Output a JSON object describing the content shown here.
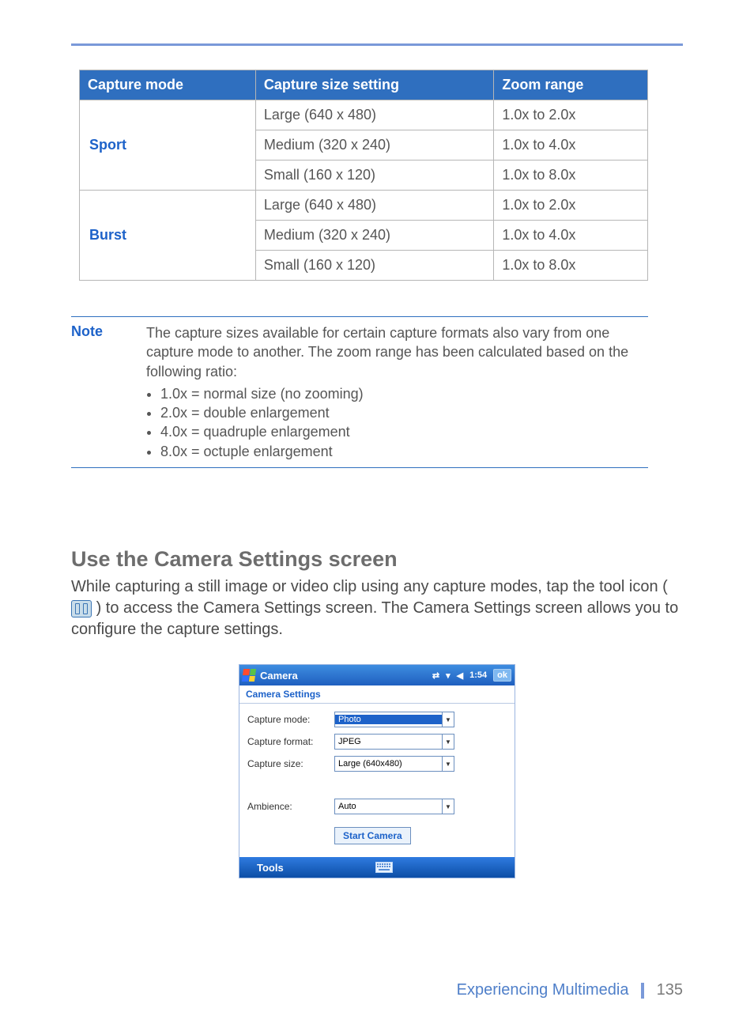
{
  "table": {
    "headers": [
      "Capture mode",
      "Capture size setting",
      "Zoom range"
    ],
    "groups": [
      {
        "mode": "Sport",
        "rows": [
          {
            "size": "Large (640 x 480)",
            "zoom": "1.0x to 2.0x"
          },
          {
            "size": "Medium (320 x 240)",
            "zoom": "1.0x to 4.0x"
          },
          {
            "size": "Small (160 x 120)",
            "zoom": "1.0x to 8.0x"
          }
        ]
      },
      {
        "mode": "Burst",
        "rows": [
          {
            "size": "Large (640 x 480)",
            "zoom": "1.0x to 2.0x"
          },
          {
            "size": "Medium (320 x 240)",
            "zoom": "1.0x to 4.0x"
          },
          {
            "size": "Small (160 x 120)",
            "zoom": "1.0x to 8.0x"
          }
        ]
      }
    ]
  },
  "note": {
    "label": "Note",
    "text": "The capture sizes available for certain capture formats also vary from one capture mode to another. The zoom range has been calculated based on the following ratio:",
    "bullets": [
      "1.0x = normal size (no zooming)",
      "2.0x = double enlargement",
      "4.0x = quadruple enlargement",
      "8.0x = octuple enlargement"
    ]
  },
  "section": {
    "heading": "Use the Camera Settings screen",
    "para_before_icon": "While capturing a still image or video clip using any capture modes, tap the tool icon ( ",
    "para_after_icon": " ) to access the Camera Settings screen. The Camera Settings screen allows you to configure the capture settings."
  },
  "device": {
    "title": "Camera",
    "time": "1:54",
    "ok": "ok",
    "subtitle": "Camera Settings",
    "fields": {
      "capture_mode": {
        "label": "Capture mode:",
        "value": "Photo"
      },
      "capture_format": {
        "label": "Capture format:",
        "value": "JPEG"
      },
      "capture_size": {
        "label": "Capture size:",
        "value": "Large (640x480)"
      },
      "ambience": {
        "label": "Ambience:",
        "value": "Auto"
      }
    },
    "start_button": "Start Camera",
    "menu_tools": "Tools"
  },
  "footer": {
    "chapter": "Experiencing Multimedia",
    "page": "135"
  }
}
